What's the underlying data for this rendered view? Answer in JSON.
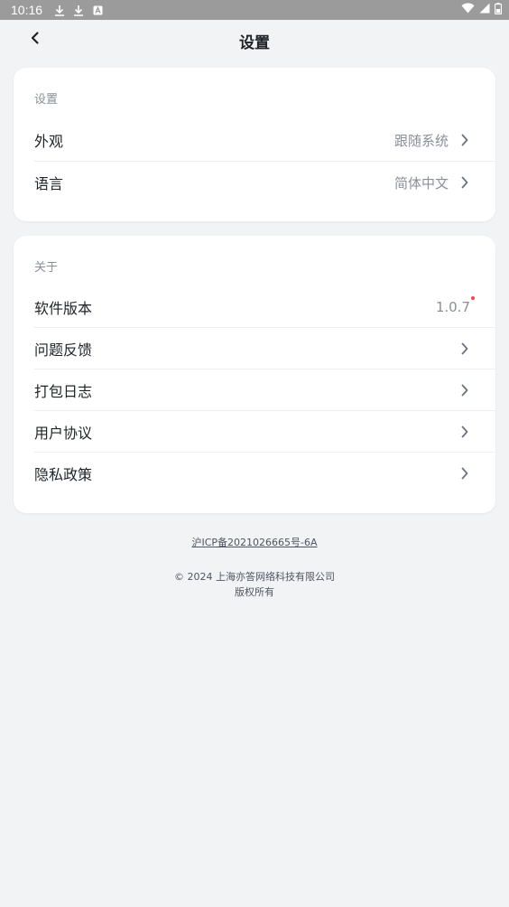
{
  "status_bar": {
    "time": "10:16",
    "left_icons": [
      "download-icon",
      "download-icon",
      "app-notification-icon"
    ],
    "right_icons": [
      "wifi-icon",
      "signal-icon",
      "battery-icon"
    ]
  },
  "nav": {
    "title": "设置",
    "back_icon": "chevron-left-icon"
  },
  "settings_section": {
    "header": "设置",
    "items": [
      {
        "label": "外观",
        "value": "跟随系统"
      },
      {
        "label": "语言",
        "value": "简体中文"
      }
    ]
  },
  "about_section": {
    "header": "关于",
    "version_label": "软件版本",
    "version_value": "1.0.7",
    "items": [
      {
        "label": "问题反馈"
      },
      {
        "label": "打包日志"
      },
      {
        "label": "用户协议"
      },
      {
        "label": "隐私政策"
      }
    ]
  },
  "footer": {
    "icp": "沪ICP备2021026665号-6A",
    "copyright": "© 2024 上海亦答网络科技有限公司",
    "rights": "版权所有"
  },
  "colors": {
    "background": "#f2f3f5",
    "status_bar": "#9b9b9b",
    "badge_dot": "#f5474a"
  }
}
